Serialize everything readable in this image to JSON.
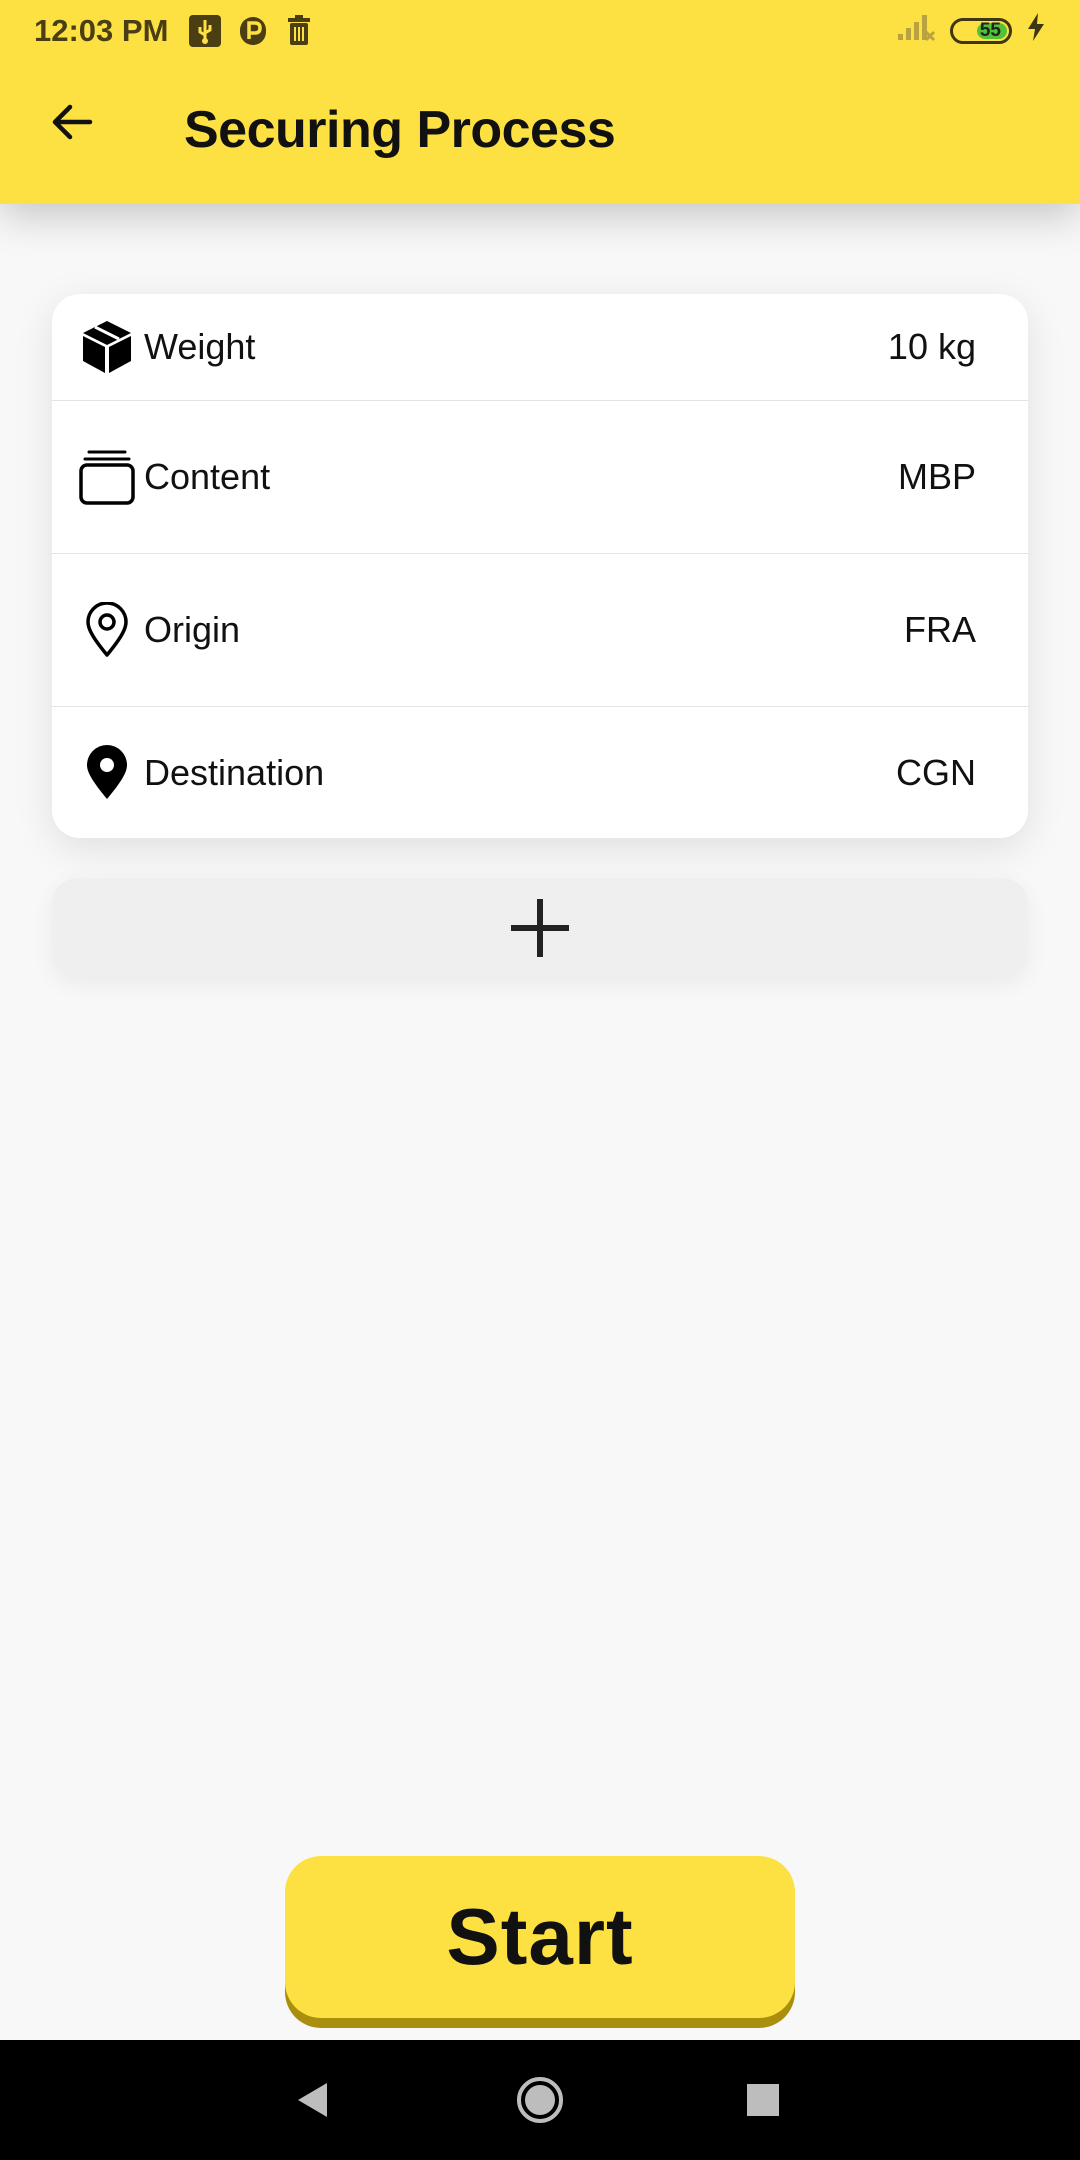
{
  "status_bar": {
    "time": "12:03 PM",
    "battery": "55",
    "icons": [
      "usb-icon",
      "parking-icon",
      "trash-icon",
      "signal-icon",
      "battery-icon",
      "charging-icon"
    ]
  },
  "header": {
    "title": "Securing Process",
    "background": "#fde143"
  },
  "details": [
    {
      "icon": "package-icon",
      "label": "Weight",
      "value": "10 kg"
    },
    {
      "icon": "stack-icon",
      "label": "Content",
      "value": "MBP"
    },
    {
      "icon": "location-outline-icon",
      "label": "Origin",
      "value": "FRA"
    },
    {
      "icon": "location-filled-icon",
      "label": "Destination",
      "value": "CGN"
    }
  ],
  "actions": {
    "add_icon": "plus-icon",
    "start_label": "Start"
  },
  "nav": {
    "icons": [
      "back-triangle-icon",
      "home-circle-icon",
      "recents-square-icon"
    ]
  }
}
